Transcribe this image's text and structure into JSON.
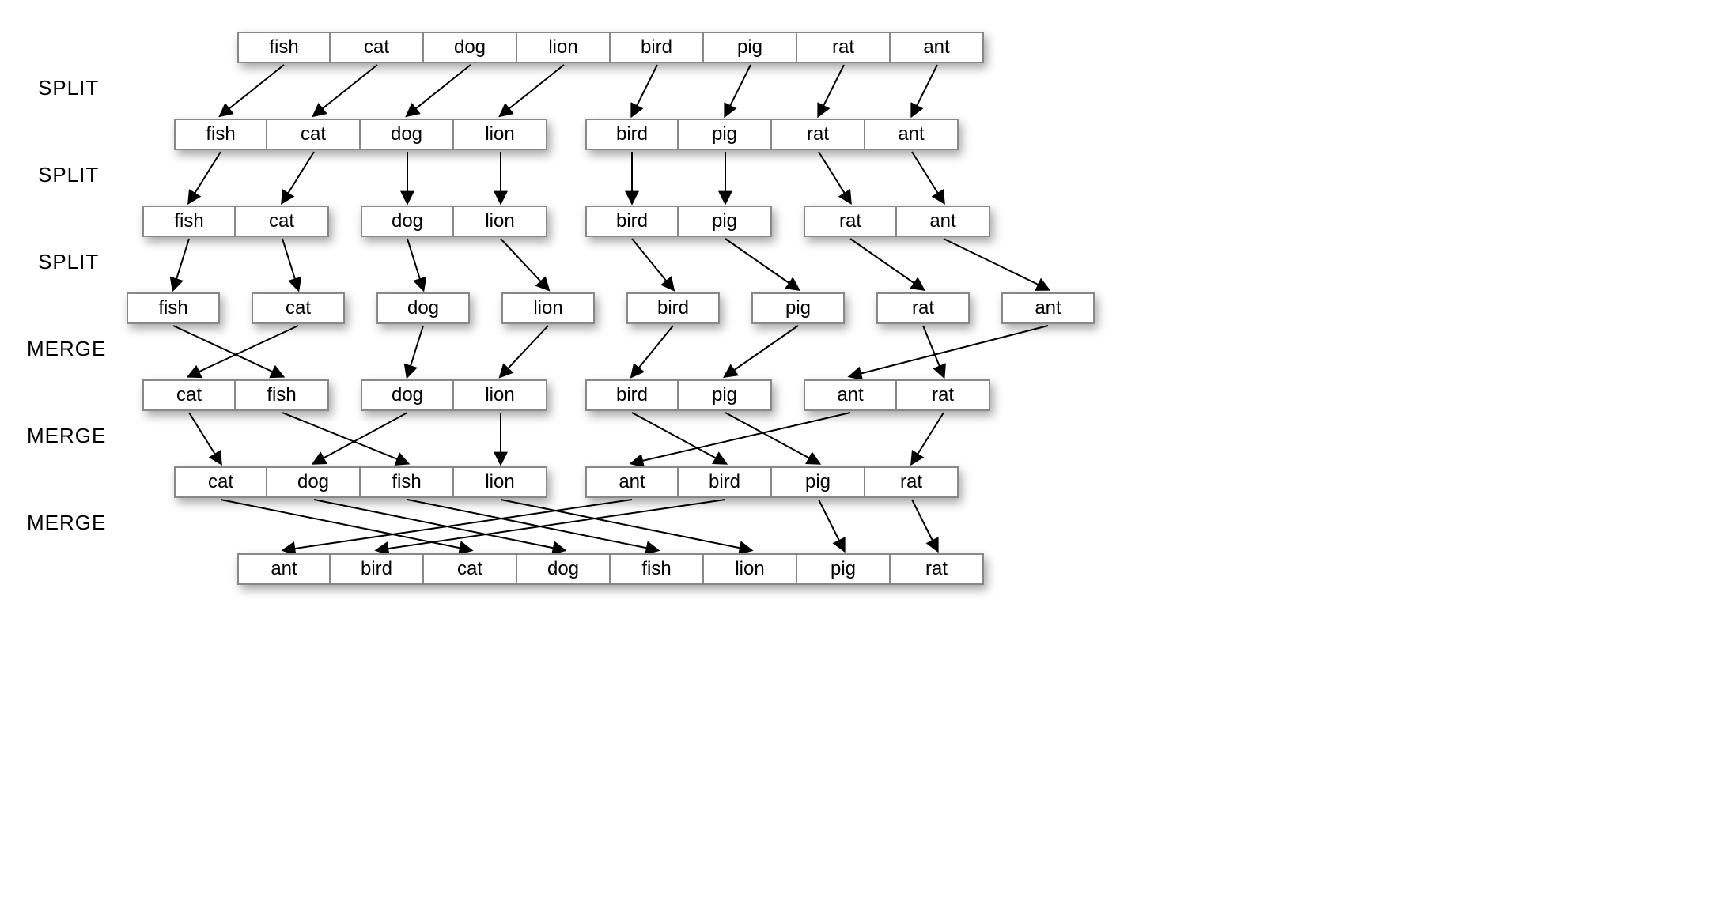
{
  "labels": {
    "split1": "SPLIT",
    "split2": "SPLIT",
    "split3": "SPLIT",
    "merge1": "MERGE",
    "merge2": "MERGE",
    "merge3": "MERGE"
  },
  "rows": {
    "r0": {
      "g0": [
        "fish",
        "cat",
        "dog",
        "lion",
        "bird",
        "pig",
        "rat",
        "ant"
      ]
    },
    "r1": {
      "g0": [
        "fish",
        "cat",
        "dog",
        "lion"
      ],
      "g1": [
        "bird",
        "pig",
        "rat",
        "ant"
      ]
    },
    "r2": {
      "g0": [
        "fish",
        "cat"
      ],
      "g1": [
        "dog",
        "lion"
      ],
      "g2": [
        "bird",
        "pig"
      ],
      "g3": [
        "rat",
        "ant"
      ]
    },
    "r3": {
      "g0": [
        "fish"
      ],
      "g1": [
        "cat"
      ],
      "g2": [
        "dog"
      ],
      "g3": [
        "lion"
      ],
      "g4": [
        "bird"
      ],
      "g5": [
        "pig"
      ],
      "g6": [
        "rat"
      ],
      "g7": [
        "ant"
      ]
    },
    "r4": {
      "g0": [
        "cat",
        "fish"
      ],
      "g1": [
        "dog",
        "lion"
      ],
      "g2": [
        "bird",
        "pig"
      ],
      "g3": [
        "ant",
        "rat"
      ]
    },
    "r5": {
      "g0": [
        "cat",
        "dog",
        "fish",
        "lion"
      ],
      "g1": [
        "ant",
        "bird",
        "pig",
        "rat"
      ]
    },
    "r6": {
      "g0": [
        "ant",
        "bird",
        "cat",
        "dog",
        "fish",
        "lion",
        "pig",
        "rat"
      ]
    }
  },
  "layout_note": "Merge sort visualization: 8 strings split to singletons then merged back alphabetically."
}
